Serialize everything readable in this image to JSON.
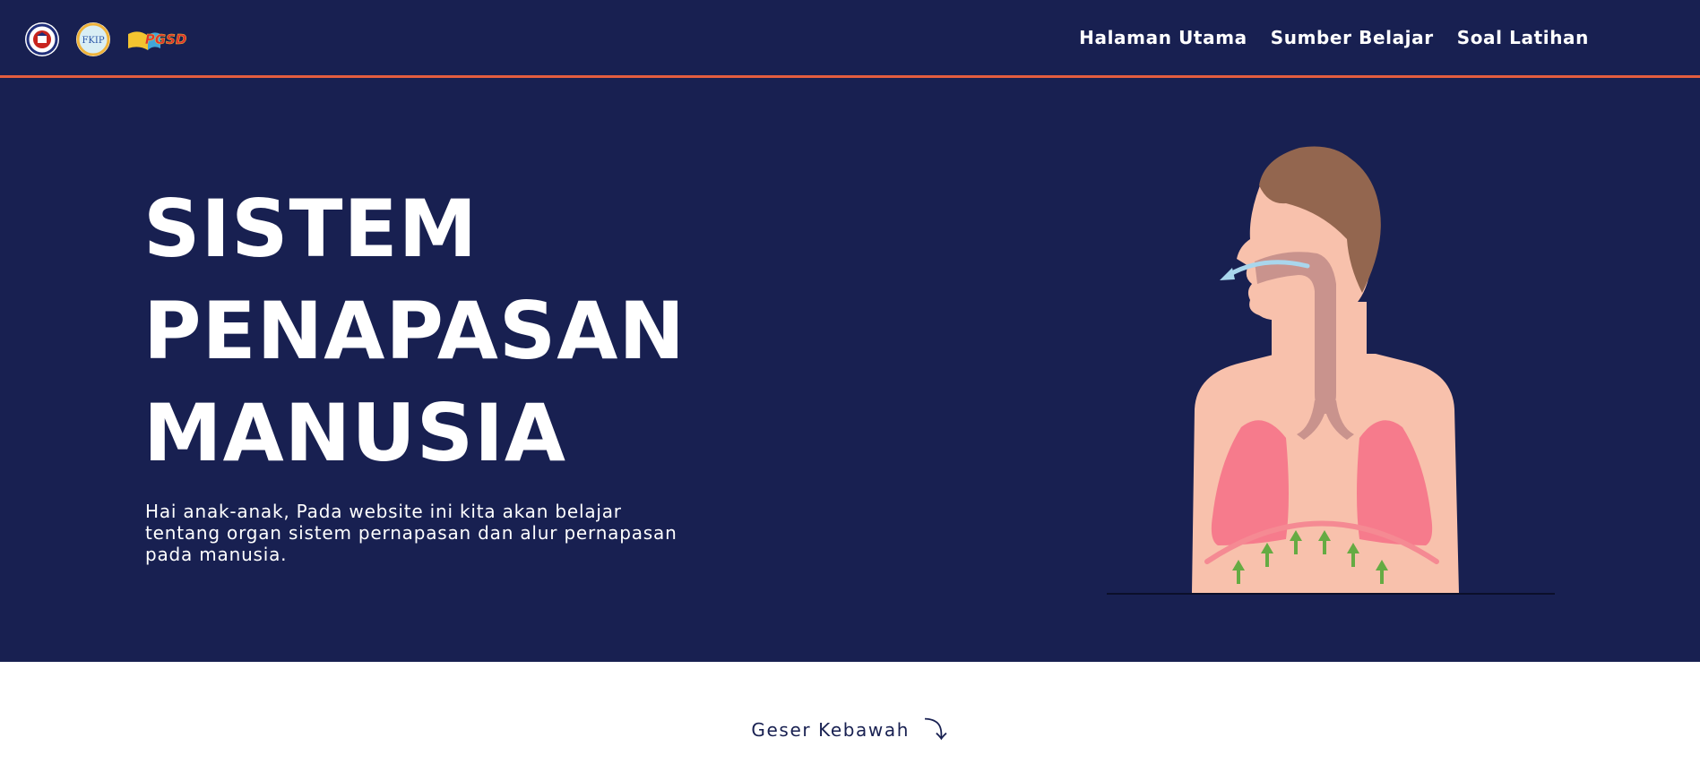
{
  "header": {
    "logos": [
      "university-seal-logo",
      "fkip-logo",
      "pgsd-logo"
    ],
    "logo_texts": [
      "FKIP",
      "PGSD"
    ],
    "nav": [
      {
        "label": "Halaman Utama"
      },
      {
        "label": "Sumber Belajar"
      },
      {
        "label": "Soal Latihan"
      }
    ]
  },
  "hero": {
    "title_lines": [
      "SISTEM",
      "PENAPASAN",
      "MANUSIA"
    ],
    "subtitle_lines": [
      "Hai anak-anak, Pada website ini kita akan belajar",
      "tentang organ sistem pernapasan dan alur pernapasan",
      "pada manusia."
    ],
    "illustration": "human-respiratory-system-illustration"
  },
  "scroll_hint": {
    "label": "Geser Kebawah",
    "icon": "arrow-down-curved-icon",
    "arrow_glyph": "⤵"
  },
  "colors": {
    "navy": "#182051",
    "accent": "#e35d3f",
    "skin": "#f8c1ac",
    "hair": "#93664f",
    "lungs": "#f67b8c",
    "diaphragm": "#f58a93",
    "arrows": "#65ab43",
    "air": "#a9d6ec"
  }
}
